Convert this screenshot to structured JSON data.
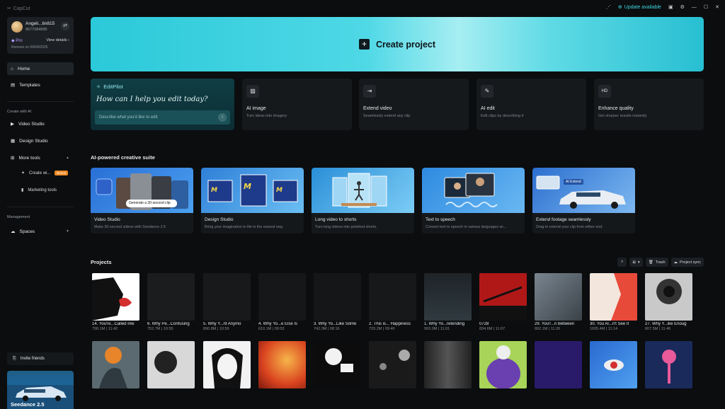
{
  "app": {
    "brand": "CapCut",
    "update_label": "Update available"
  },
  "account": {
    "name": "Angeli...tin815",
    "id": "9577084995",
    "plan": "Pro",
    "view_details": "View details",
    "renews": "Renews on 09/04/2026"
  },
  "sidebar": {
    "home": "Home",
    "templates": "Templates",
    "create_with_ai": "Create with AI",
    "video_studio": "Video Studio",
    "design_studio": "Design Studio",
    "more_tools": "More tools",
    "create_wi": "Create wi...",
    "bonus": "Bonus",
    "marketing_tools": "Marketing tools",
    "management": "Management",
    "spaces": "Spaces",
    "invite_friends": "Invite friends",
    "promo": "Seedance 2.5"
  },
  "create_project": "Create project",
  "editpilot": {
    "title": "EditPilot",
    "question": "How can I help you edit today?",
    "placeholder": "Describe what you'd like to edit"
  },
  "tools": [
    {
      "title": "AI image",
      "subtitle": "Turn ideas into imagery",
      "icon": "image-icon"
    },
    {
      "title": "Extend video",
      "subtitle": "Seamlessly extend any clip",
      "icon": "extend-icon"
    },
    {
      "title": "AI edit",
      "subtitle": "Edit clips by describing it",
      "icon": "magic-wand-icon"
    },
    {
      "title": "Enhance quality",
      "subtitle": "Get sharper results instantly",
      "icon": "hd-icon"
    }
  ],
  "suite_heading": "AI-powered creative suite",
  "suite": [
    {
      "title": "Video Studio",
      "subtitle": "Make 30-second videos with Seedance 2.5",
      "tag": "Generate a 30-second clip"
    },
    {
      "title": "Design Studio",
      "subtitle": "Bring your imagination to life in the easiest way."
    },
    {
      "title": "Long video to shorts",
      "subtitle": "Turn long videos into polished shorts."
    },
    {
      "title": "Text to speech",
      "subtitle": "Convert text to speech in various languages wi..."
    },
    {
      "title": "Extend footage seamlessly",
      "subtitle": "Drag to extend your clip from either end.",
      "tag": "AI Extend"
    }
  ],
  "projects_heading": "Projects",
  "project_tools": {
    "trash": "Trash",
    "sync": "Project sync"
  },
  "projects_row1": [
    {
      "title": "14. You're...Called Inw",
      "meta": "798.1M | 11:42"
    },
    {
      "title": "6. Why Pe...Confusing",
      "meta": "752.7M | 10:55"
    },
    {
      "title": "5. Why Y...nt Anymo",
      "meta": "890.8M | 10:59"
    },
    {
      "title": "4. Why Yo...e Else Is",
      "meta": "610.1M | 09:53"
    },
    {
      "title": "3. Why Yo...Like Some",
      "meta": "742.0M | 08:16"
    },
    {
      "title": "2. This is... Happiness",
      "meta": "733.2M | 09:40"
    },
    {
      "title": "1. Why Yo...retending",
      "meta": "993.0M | 11:01"
    },
    {
      "title": "0728",
      "meta": "834.6M | 11:07"
    },
    {
      "title": "29. You'r...n Between",
      "meta": "892.1M | 11:26"
    },
    {
      "title": "30. You Al...n't See It",
      "meta": "1005.4M | 11:14"
    },
    {
      "title": "27. Why Y...ike Enoug",
      "meta": "807.5M | 11:46"
    }
  ]
}
